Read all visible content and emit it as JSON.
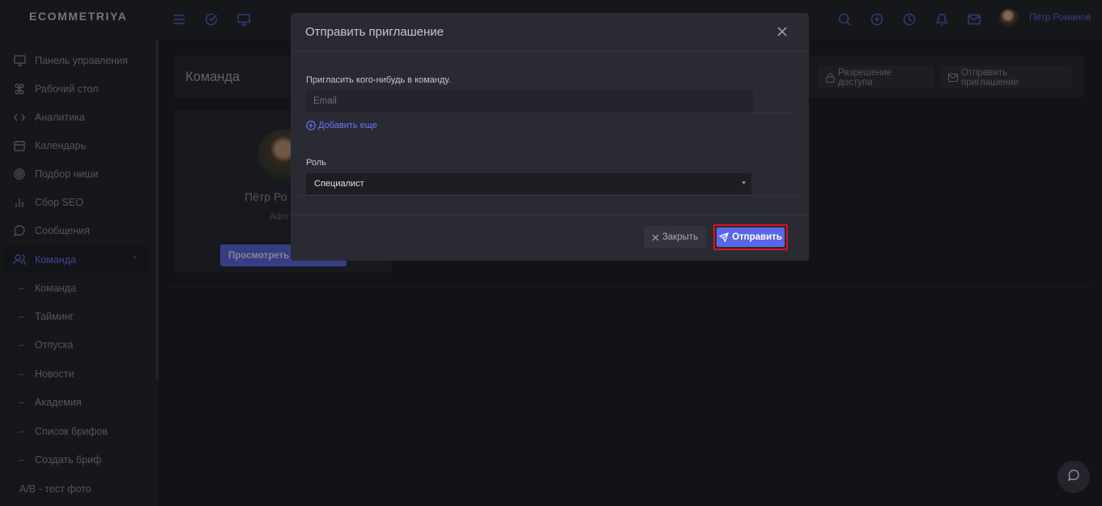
{
  "app": {
    "logo": "ECOMMETRIYA"
  },
  "sidebar": {
    "items": [
      {
        "label": "Панель управления",
        "icon": "monitor-icon"
      },
      {
        "label": "Рабочий стол",
        "icon": "command-icon"
      },
      {
        "label": "Аналитика",
        "icon": "code-icon"
      },
      {
        "label": "Календарь",
        "icon": "calendar-icon"
      },
      {
        "label": "Подбор ниши",
        "icon": "target-icon"
      },
      {
        "label": "Сбор SEO",
        "icon": "bar-chart-icon"
      },
      {
        "label": "Сообщения",
        "icon": "message-circle-icon"
      },
      {
        "label": "Команда",
        "icon": "users-icon",
        "active": true
      }
    ],
    "subitems": [
      {
        "label": "Команда"
      },
      {
        "label": "Тайминг"
      },
      {
        "label": "Отпуска"
      },
      {
        "label": "Новости"
      },
      {
        "label": "Академия"
      },
      {
        "label": "Список брифов"
      },
      {
        "label": "Создать бриф"
      }
    ],
    "extra_item": "A/B - тест фото"
  },
  "topbar": {
    "left_icons": [
      "menu-icon",
      "check-circle-icon",
      "monitor-icon"
    ],
    "right_icons": [
      "search-icon",
      "plus-circle-icon",
      "clock-icon",
      "bell-icon",
      "mail-icon"
    ],
    "user_name": "Пётр Романов"
  },
  "page": {
    "title": "Команда",
    "buttons": {
      "access": "Разрешение доступа",
      "invite": "Отправить приглашение"
    },
    "card": {
      "name": "Пётр Ро",
      "role": "Adm",
      "button": "Просмотреть п"
    }
  },
  "modal": {
    "title": "Отправить приглашение",
    "invite_label": "Пригласить кого-нибудь в команду.",
    "email_placeholder": "Email",
    "add_more": "Добавить еще",
    "role_label": "Роль",
    "role_value": "Специалист",
    "close_button": "Закрыть",
    "send_button": "Отправить"
  },
  "colors": {
    "accent": "#5c66e8",
    "highlight": "#e0101a",
    "background": "#191a1f"
  }
}
